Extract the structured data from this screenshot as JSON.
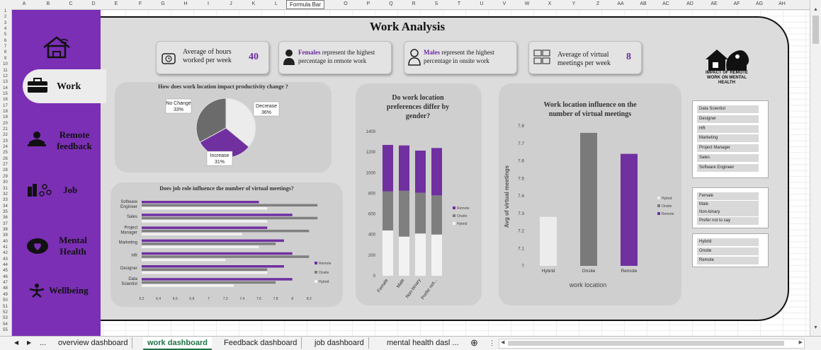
{
  "formula_tip": "Formula Bar",
  "columns": [
    "A",
    "B",
    "C",
    "D",
    "E",
    "F",
    "G",
    "H",
    "I",
    "J",
    "K",
    "L",
    "M",
    "N",
    "O",
    "P",
    "Q",
    "R",
    "S",
    "T",
    "U",
    "V",
    "W",
    "X",
    "Y",
    "Z",
    "AA",
    "AB",
    "AC",
    "AD",
    "AE",
    "AF",
    "AG",
    "AH"
  ],
  "title": "Work Analysis",
  "sidebar": {
    "items": [
      {
        "label": ""
      },
      {
        "label": "Work"
      },
      {
        "label": "Remote feedback"
      },
      {
        "label": "Job"
      },
      {
        "label": "Mental Health"
      },
      {
        "label": "Wellbeing"
      }
    ]
  },
  "kpis": [
    {
      "text": "Average of hours worked per week",
      "value": "40"
    },
    {
      "highlight": "Females",
      "text": " represent the highest percentage in remote work"
    },
    {
      "highlight": "Males",
      "text": " represent the highest percentage in onsite work"
    },
    {
      "text": "Average of virtual meetings per week",
      "value": "8"
    }
  ],
  "logo_text": "IMPACT OF REMOTE WORK ON MENTAL HEALTH",
  "slicers": {
    "job_roles": [
      "Data Scientist",
      "Designer",
      "HR",
      "Marketing",
      "Project Manager",
      "Sales",
      "Software Engineer"
    ],
    "genders": [
      "Female",
      "Male",
      "Non-binary",
      "Prefer not to say"
    ],
    "locations": [
      "Hybrid",
      "Onsite",
      "Remote"
    ]
  },
  "colors": {
    "remote": "#7030a0",
    "onsite": "#7f7f7f",
    "hybrid": "#f2f2f2",
    "sidebar": "#7b2fb5"
  },
  "chart_data": [
    {
      "type": "pie",
      "title": "How does work location impact productivity change ?",
      "categories": [
        "Decrease",
        "Increase",
        "No Change"
      ],
      "values": [
        36,
        31,
        33
      ],
      "labels": [
        "Decrease 36%",
        "Increase 31%",
        "No Change 33%"
      ]
    },
    {
      "type": "bar",
      "stacked": true,
      "title": "Do work location preferences differ by gender?",
      "categories": [
        "Female",
        "Male",
        "Non-binary",
        "Prefer not..."
      ],
      "series": [
        {
          "name": "Hybrid",
          "values": [
            440,
            380,
            410,
            400
          ]
        },
        {
          "name": "Onsite",
          "values": [
            380,
            445,
            395,
            380
          ]
        },
        {
          "name": "Remote",
          "values": [
            450,
            440,
            410,
            460
          ]
        }
      ],
      "ylim": [
        0,
        1400
      ],
      "yticks": [
        0,
        200,
        400,
        600,
        800,
        1000,
        1200,
        1400
      ]
    },
    {
      "type": "bar",
      "title": "Work location influence on the number of virtual meetings",
      "categories": [
        "Hybrid",
        "Onsite",
        "Remote"
      ],
      "values": [
        7.28,
        7.76,
        7.64
      ],
      "ylabel": "Avg of virtual meetings",
      "xlabel": "work location",
      "ylim": [
        7,
        7.8
      ],
      "yticks": [
        "7",
        "7.1",
        "7.2",
        "7.3",
        "7.4",
        "7.5",
        "7.6",
        "7.7",
        "7.8"
      ],
      "legend": [
        "Hybrid",
        "Onsite",
        "Remote"
      ]
    },
    {
      "type": "bar",
      "orientation": "horizontal",
      "title": "Does job role influence the number of virtual meetings?",
      "categories": [
        "Software Engineer",
        "Sales",
        "Project Manager",
        "Marketing",
        "HR",
        "Designer",
        "Data Scientist"
      ],
      "series": [
        {
          "name": "Remote",
          "values": [
            7.6,
            8.0,
            7.7,
            7.9,
            8.0,
            7.9,
            8.0
          ]
        },
        {
          "name": "Onsite",
          "values": [
            8.3,
            8.3,
            8.2,
            7.8,
            8.2,
            7.7,
            7.8
          ]
        },
        {
          "name": "Hybrid",
          "values": [
            7.7,
            7.7,
            7.4,
            7.6,
            7.2,
            7.7,
            7.3
          ]
        }
      ],
      "xlim": [
        6.2,
        8.4
      ],
      "xticks": [
        "6.2",
        "6.4",
        "6.6",
        "6.8",
        "7",
        "7.2",
        "7.4",
        "7.6",
        "7.8",
        "8",
        "8.2"
      ]
    }
  ],
  "tabs": {
    "nav": [
      "◀",
      "▶",
      "..."
    ],
    "sheets": [
      "overview dashboard",
      "work dashboard",
      "Feedback dashboard",
      "job dashboard",
      "mental health dasl ..."
    ],
    "active": "work dashboard",
    "add": "⊕"
  }
}
